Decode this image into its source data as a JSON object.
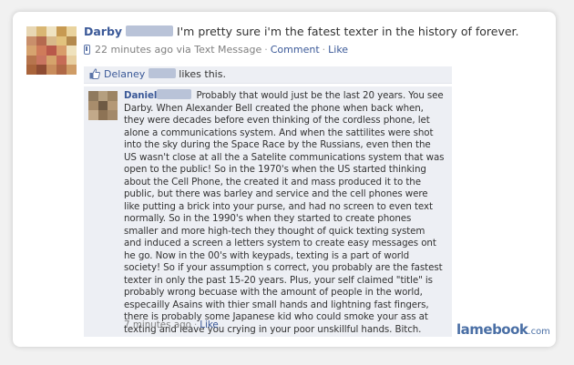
{
  "post": {
    "author": "Darby",
    "text": "I'm pretty sure i'm the fatest texter in the history of forever.",
    "time": "22 minutes ago via Text Message",
    "comment_link": "Comment",
    "like_link": "Like"
  },
  "likes": {
    "liker": "Delaney",
    "text": "likes this."
  },
  "comment": {
    "author": "Daniel",
    "text": "Probably that would just be the last 20 years. You see Darby. When Alexander Bell created the phone when back when, they were decades before even thinking of the cordless phone, let alone a communications system. And when the sattilites were shot into the sky during the Space Race by the Russians, even then the US wasn't close at all the a Satelite communications system that was open to the public! So in the 1970's when the US started thinking about the Cell Phone, the created it and mass produced it to the public, but there was barley and service and the cell phones were like putting a brick into your purse, and had no screen to even text normally. So in the 1990's when they started to create phones smaller and more high-tech they thought of quick texting system and induced a screen a letters system to create easy messages ont he go. Now in the 00's with keypads, texting is a part of world society! So if your assumption s correct, you probably are the fastest texter in only the past 15-20 years. Plus, your self claimed \"title\" is probably wrong becuase with the amount of people in the world, especailly Asains with thier small hands and lightning fast fingers, there is probably some Japanese kid who could smoke your ass at texting and leave you crying in your poor unskillful hands. Bitch.",
    "time": "7 minutes ago",
    "like_link": "Like"
  },
  "watermark": {
    "brand": "lamebook",
    "tld": ".com"
  },
  "colors": {
    "link": "#3b5998",
    "comment_bg": "#edeff4",
    "meta_gray": "#808080"
  },
  "icons": [
    "mobile-phone-icon",
    "thumbs-up-icon"
  ]
}
